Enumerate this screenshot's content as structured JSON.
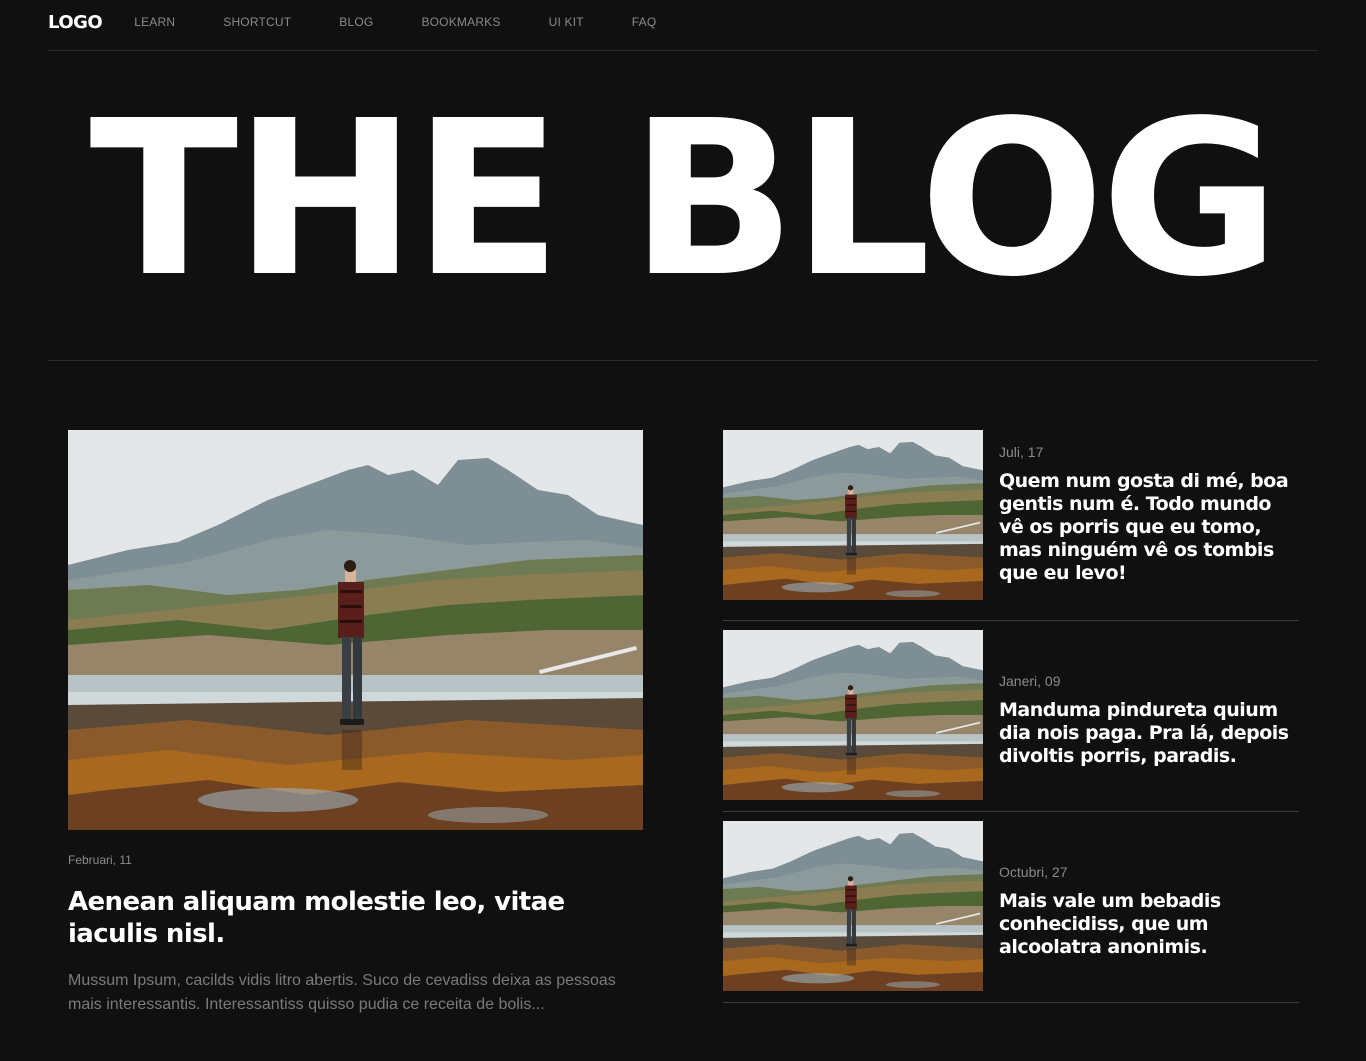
{
  "nav": {
    "logo": "LOGO",
    "links": [
      "LEARN",
      "SHORTCUT",
      "BLOG",
      "BOOKMARKS",
      "UI KIT",
      "FAQ"
    ]
  },
  "hero": {
    "title": "THE BLOG"
  },
  "featured": {
    "date": "Februari, 11",
    "title": "Aenean aliquam molestie leo, vitae iaculis nisl.",
    "excerpt": "Mussum Ipsum, cacilds vidis litro abertis. Suco de cevadiss deixa as pessoas mais interessantis. Interessantiss quisso pudia ce receita de bolis..."
  },
  "side_posts": [
    {
      "date": "Juli, 17",
      "title": "Quem num gosta di mé, boa gentis num é. Todo mundo vê os porris que eu tomo, mas ninguém vê os tombis que eu levo!"
    },
    {
      "date": "Janeri, 09",
      "title": "Manduma pindureta quium dia nois paga. Pra lá, depois divoltis porris, paradis."
    },
    {
      "date": "Octubri, 27",
      "title": "Mais vale um bebadis conhecidiss, que um alcoolatra anonimis."
    }
  ],
  "colors": {
    "background": "#101010",
    "divider": "#2b2b2b",
    "muted_text": "#8a8a8a",
    "text": "#ffffff"
  }
}
